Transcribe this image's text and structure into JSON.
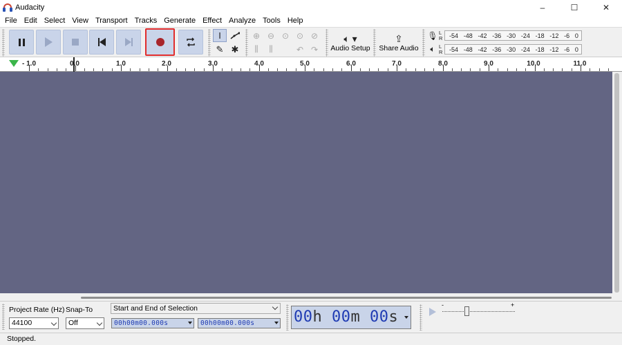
{
  "window": {
    "title": "Audacity",
    "minimize": "–",
    "maximize": "☐",
    "close": "✕"
  },
  "menu": [
    "File",
    "Edit",
    "Select",
    "View",
    "Transport",
    "Tracks",
    "Generate",
    "Effect",
    "Analyze",
    "Tools",
    "Help"
  ],
  "toolbar": {
    "audio_setup_label": "Audio Setup",
    "share_audio_label": "Share Audio",
    "meter_L": "L",
    "meter_R": "R",
    "meter_ticks": [
      "-54",
      "-48",
      "-42",
      "-36",
      "-30",
      "-24",
      "-18",
      "-12",
      "-6",
      "0"
    ]
  },
  "ruler": {
    "labels": [
      "- 1.0",
      "0.0",
      "1.0",
      "2.0",
      "3.0",
      "4.0",
      "5.0",
      "6.0",
      "7.0",
      "8.0",
      "9.0",
      "10.0",
      "11.0"
    ]
  },
  "bottom": {
    "project_rate_label": "Project Rate (Hz)",
    "project_rate_value": "44100",
    "snap_to_label": "Snap-To",
    "snap_to_value": "Off",
    "selection_mode": "Start and End of Selection",
    "selection_start": "00h00m00.000s",
    "selection_end": "00h00m00.000s",
    "big_time": {
      "h_val": "00",
      "h_unit": "h",
      "m_val": "00",
      "m_unit": "m",
      "s_val": "00",
      "s_unit": "s"
    },
    "speed_min": "-",
    "speed_max": "+"
  },
  "status": {
    "text": "Stopped."
  },
  "colors": {
    "track_bg": "#636583",
    "button_bg": "#c9d4e9",
    "record_highlight": "#e12c2c",
    "record_dot": "#a8252b",
    "time_digits": "#1f3bb3"
  }
}
